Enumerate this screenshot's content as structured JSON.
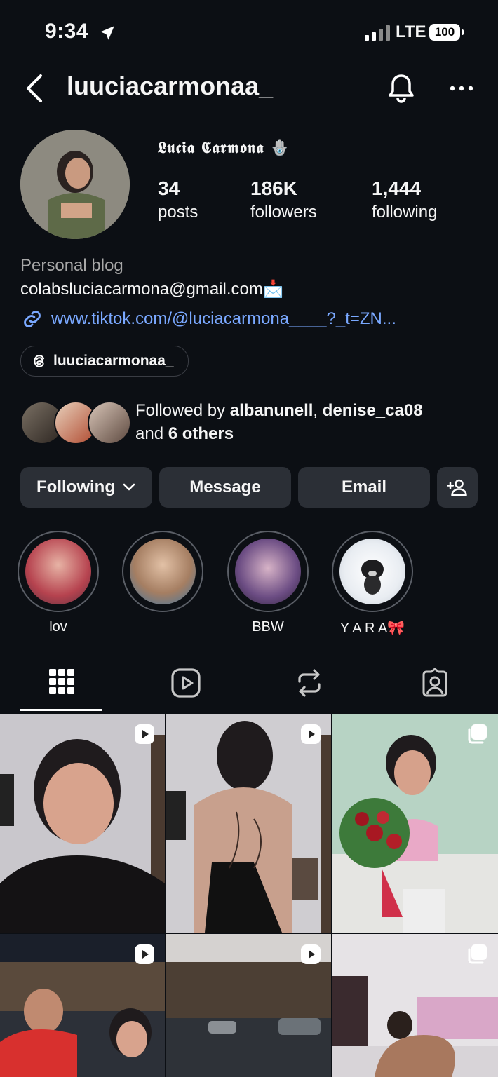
{
  "status_bar": {
    "time": "9:34",
    "network": "LTE",
    "battery": "100"
  },
  "header": {
    "username": "luuciacarmonaa_"
  },
  "profile": {
    "display_name": "𝕷𝖚𝖈𝖎𝖆 𝕮𝖆𝖗𝖒𝖔𝖓𝖆",
    "display_emoji": "🪬",
    "stats": [
      {
        "value": "34",
        "label": "posts"
      },
      {
        "value": "186K",
        "label": "followers"
      },
      {
        "value": "1,444",
        "label": "following"
      }
    ],
    "category": "Personal blog",
    "email": "colabsluciacarmona@gmail.com",
    "email_emoji": "📩",
    "link": "www.tiktok.com/@luciacarmona____?_t=ZN...",
    "threads_handle": "luuciacarmonaa_"
  },
  "followed_by": {
    "prefix": "Followed by ",
    "user1": "albanunell",
    "sep": ", ",
    "user2": "denise_ca08",
    "and": "and ",
    "others": "6 others"
  },
  "buttons": {
    "following": "Following",
    "message": "Message",
    "email": "Email"
  },
  "highlights": [
    {
      "label": "lov"
    },
    {
      "label": ""
    },
    {
      "label": "BBW"
    },
    {
      "label": "Y A R A🎀"
    }
  ],
  "tabs": [
    "grid",
    "reels",
    "reposts",
    "tagged"
  ],
  "colors": {
    "background": "#0c0f14",
    "button": "#2b2f36",
    "link": "#7aa8ff",
    "muted": "#a8a8a8"
  }
}
